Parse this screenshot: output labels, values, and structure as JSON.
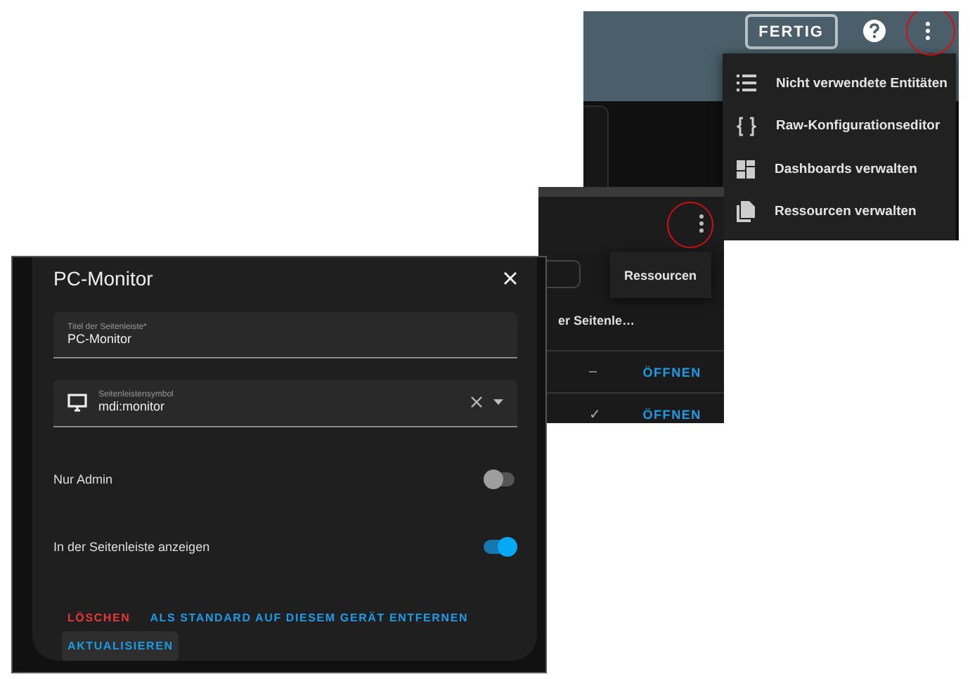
{
  "top_screenshot": {
    "done_button": "FERTIG",
    "menu": [
      {
        "label": "Nicht verwendete Entitäten",
        "kind": "list"
      },
      {
        "label": "Raw-Konfigurationseditor",
        "kind": "braces"
      },
      {
        "label": "Dashboards verwalten",
        "kind": "dashboard"
      },
      {
        "label": "Ressourcen verwalten",
        "kind": "file"
      }
    ]
  },
  "middle_screenshot": {
    "menu": [
      "Ressourcen"
    ],
    "heading": "er Seitenle…",
    "rows": [
      {
        "value": "–",
        "action": "ÖFFNEN"
      },
      {
        "value": "✓",
        "action": "ÖFFNEN"
      }
    ]
  },
  "dialog": {
    "title": "PC-Monitor",
    "fields": [
      {
        "label": "Titel der Seitenleiste*",
        "value": "PC-Monitor",
        "kind": "text"
      },
      {
        "label": "Seitenleistensymbol",
        "value": "mdi:monitor",
        "kind": "icon"
      }
    ],
    "toggles": [
      {
        "label": "Nur Admin",
        "on": false
      },
      {
        "label": "In der Seitenleiste anzeigen",
        "on": true
      }
    ],
    "actions": [
      {
        "label": "LÖSCHEN",
        "kind": "danger"
      },
      {
        "label": "ALS STANDARD AUF DIESEM GERÄT ENTFERNEN",
        "kind": "text"
      },
      {
        "label": "AKTUALISIEREN",
        "kind": "filled"
      }
    ]
  }
}
